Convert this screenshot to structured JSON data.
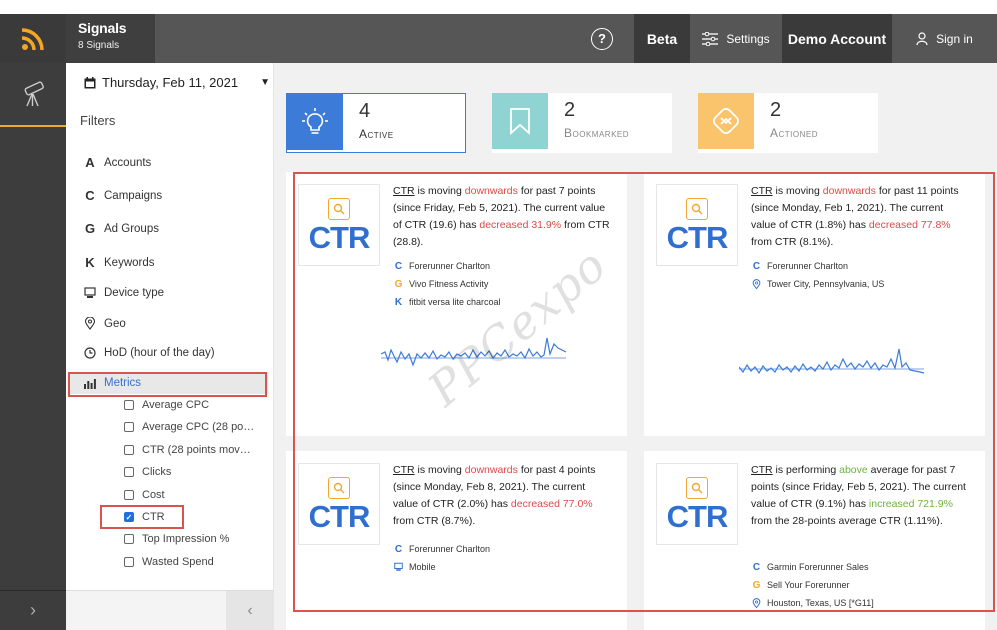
{
  "app": {
    "title": "Signals",
    "subtitle": "8 Signals"
  },
  "topbar": {
    "help_glyph": "?",
    "beta_label": "Beta",
    "settings_label": "Settings",
    "account_label": "Demo Account",
    "signin_label": "Sign in"
  },
  "filters": {
    "date": "Thursday, Feb 11, 2021",
    "heading": "Filters",
    "items": [
      {
        "icon": "A",
        "label": "Accounts"
      },
      {
        "icon": "C",
        "label": "Campaigns"
      },
      {
        "icon": "G",
        "label": "Ad Groups"
      },
      {
        "icon": "K",
        "label": "Keywords"
      },
      {
        "icon": "device-type-icon",
        "label": "Device type"
      },
      {
        "icon": "location-pin-icon",
        "label": "Geo"
      },
      {
        "icon": "clock-icon",
        "label": "HoD (hour of the day)"
      }
    ],
    "metrics_label": "Metrics",
    "metrics": [
      {
        "label": "Average CPC",
        "checked": false
      },
      {
        "label": "Average CPC (28 po…",
        "checked": false
      },
      {
        "label": "CTR (28 points mov…",
        "checked": false
      },
      {
        "label": "Clicks",
        "checked": false
      },
      {
        "label": "Cost",
        "checked": false
      },
      {
        "label": "CTR",
        "checked": true
      },
      {
        "label": "Top Impression %",
        "checked": false
      },
      {
        "label": "Wasted Spend",
        "checked": false
      }
    ]
  },
  "stats": [
    {
      "value": "4",
      "label": "Active",
      "color": "#3d7bd9"
    },
    {
      "value": "2",
      "label": "Bookmarked",
      "color": "#8fd3d3"
    },
    {
      "value": "2",
      "label": "Actioned",
      "color": "#f9c46b"
    }
  ],
  "cards": [
    {
      "badge": "CTR",
      "metric": "CTR",
      "t1": " is moving ",
      "trend": "downwards",
      "t2": " for past 7 points (since Friday, Feb 5, 2021). The current value of CTR (19.6) has ",
      "change": "decreased 31.9%",
      "t3": " from CTR (28.8).",
      "tags": [
        {
          "icon": "C",
          "label": "Forerunner Charlton"
        },
        {
          "icon": "G",
          "label": "Vivo Fitness Activity"
        },
        {
          "icon": "K",
          "label": "fitbit versa lite charcoal"
        }
      ]
    },
    {
      "badge": "CTR",
      "metric": "CTR",
      "t1": " is moving ",
      "trend": "downwards",
      "t2": " for past 11 points (since Monday, Feb 1, 2021). The current value of CTR (1.8%) has ",
      "change": "decreased 77.8%",
      "t3": " from CTR (8.1%).",
      "tags": [
        {
          "icon": "C",
          "label": "Forerunner Charlton"
        },
        {
          "icon": "location-pin-icon",
          "label": "Tower City, Pennsylvania, US"
        }
      ]
    },
    {
      "badge": "CTR",
      "metric": "CTR",
      "t1": " is moving ",
      "trend": "downwards",
      "t2": " for past 4 points (since Monday, Feb 8, 2021). The current value of CTR (2.0%) has ",
      "change": "decreased 77.0%",
      "t3": " from CTR (8.7%).",
      "tags": [
        {
          "icon": "C",
          "label": "Forerunner Charlton"
        },
        {
          "icon": "device-type-icon",
          "label": "Mobile"
        }
      ]
    },
    {
      "badge": "CTR",
      "metric": "CTR",
      "t1": " is performing ",
      "trend": "above",
      "t2": " average for past 7 points (since Friday, Feb 5, 2021). The current value of CTR (9.1%) has ",
      "change": "increased 721.9%",
      "t3": " from the 28-points average CTR (1.11%).",
      "tags": [
        {
          "icon": "C",
          "label": "Garmin Forerunner Sales"
        },
        {
          "icon": "G",
          "label": "Sell Your Forerunner"
        },
        {
          "icon": "location-pin-icon",
          "label": "Houston, Texas, US [*G11]"
        }
      ]
    }
  ],
  "watermark": "PPCexpo",
  "colors": {
    "accent": "#3d7bd9",
    "brand_orange": "#f5a623",
    "decrease": "#e04848",
    "increase": "#6fb33a",
    "highlight_box": "#d9534f"
  }
}
